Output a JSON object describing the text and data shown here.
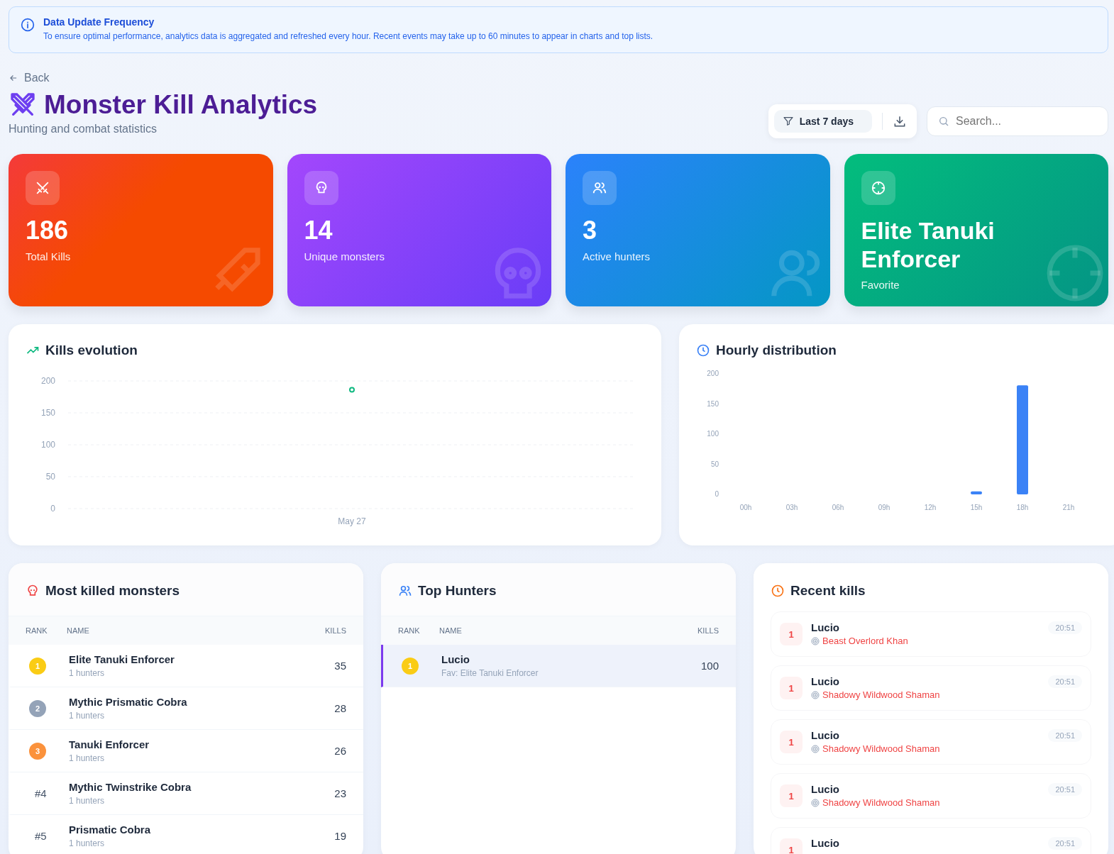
{
  "notice": {
    "title": "Data Update Frequency",
    "text": "To ensure optimal performance, analytics data is aggregated and refreshed every hour. Recent events may take up to 60 minutes to appear in charts and top lists."
  },
  "back": "Back",
  "header": {
    "title": "Monster Kill Analytics",
    "subtitle": "Hunting and combat statistics",
    "filter": "Last 7 days",
    "search": {
      "placeholder": "Search..."
    }
  },
  "stats": [
    {
      "kind": "kills",
      "value": "186",
      "label": "Total Kills"
    },
    {
      "kind": "monsters",
      "value": "14",
      "label": "Unique monsters"
    },
    {
      "kind": "hunters",
      "value": "3",
      "label": "Active hunters"
    },
    {
      "kind": "target",
      "value": "Elite Tanuki Enforcer",
      "label": "Favorite"
    }
  ],
  "kills_evolution": {
    "title": "Kills evolution",
    "chart_data": {
      "type": "line",
      "categories": [
        "May 27"
      ],
      "series": [
        {
          "color": "#10b981",
          "marker": true,
          "values": [
            186
          ]
        }
      ],
      "ylim": [
        0,
        200
      ],
      "yticks": [
        0,
        50,
        100,
        150,
        200
      ],
      "grid": true
    }
  },
  "hourly": {
    "title": "Hourly distribution",
    "chart_data": {
      "type": "bar",
      "x": [
        15,
        18
      ],
      "series": [
        {
          "color": "#3b82f6",
          "values": [
            5,
            181
          ]
        }
      ],
      "xlim": [
        0,
        21
      ],
      "ylim": [
        0,
        200
      ],
      "yticks": [
        0,
        50,
        100,
        150,
        200
      ],
      "xticks": [
        {
          "value": 0,
          "label": "00h"
        },
        {
          "value": 3,
          "label": "03h"
        },
        {
          "value": 6,
          "label": "06h"
        },
        {
          "value": 9,
          "label": "09h"
        },
        {
          "value": 12,
          "label": "12h"
        },
        {
          "value": 15,
          "label": "15h"
        },
        {
          "value": 18,
          "label": "18h"
        },
        {
          "value": 21,
          "label": "21h"
        }
      ]
    }
  },
  "monsters": {
    "title": "Most killed monsters",
    "columns": [
      "RANK",
      "NAME",
      "KILLS"
    ],
    "rows": [
      {
        "kind": "medal",
        "rank": "1",
        "color": "#facc15",
        "name": "Elite Tanuki Enforcer",
        "sub": "1 hunters",
        "kills": "35"
      },
      {
        "kind": "medal",
        "rank": "2",
        "color": "#94a3b8",
        "name": "Mythic Prismatic Cobra",
        "sub": "1 hunters",
        "kills": "28"
      },
      {
        "kind": "medal",
        "rank": "3",
        "color": "#fb923c",
        "name": "Tanuki Enforcer",
        "sub": "1 hunters",
        "kills": "26"
      },
      {
        "kind": "plain",
        "rank": "#4",
        "name": "Mythic Twinstrike Cobra",
        "sub": "1 hunters",
        "kills": "23"
      },
      {
        "kind": "plain",
        "rank": "#5",
        "name": "Prismatic Cobra",
        "sub": "1 hunters",
        "kills": "19"
      }
    ]
  },
  "hunters": {
    "title": "Top Hunters",
    "columns": [
      "RANK",
      "NAME",
      "KILLS"
    ],
    "rows": [
      {
        "kind": "medal",
        "rank": "1",
        "color": "#facc15",
        "name": "Lucio",
        "sub": "Fav: Elite Tanuki Enforcer",
        "kills": "100",
        "selected": true
      }
    ]
  },
  "recent": {
    "title": "Recent kills",
    "items": [
      {
        "rank": "1",
        "hunter": "Lucio",
        "target": "Beast Overlord Khan",
        "time": "20:51"
      },
      {
        "rank": "1",
        "hunter": "Lucio",
        "target": "Shadowy Wildwood Shaman",
        "time": "20:51"
      },
      {
        "rank": "1",
        "hunter": "Lucio",
        "target": "Shadowy Wildwood Shaman",
        "time": "20:51"
      },
      {
        "rank": "1",
        "hunter": "Lucio",
        "target": "Shadowy Wildwood Shaman",
        "time": "20:51"
      },
      {
        "rank": "1",
        "hunter": "Lucio",
        "time": "20:51"
      }
    ]
  }
}
